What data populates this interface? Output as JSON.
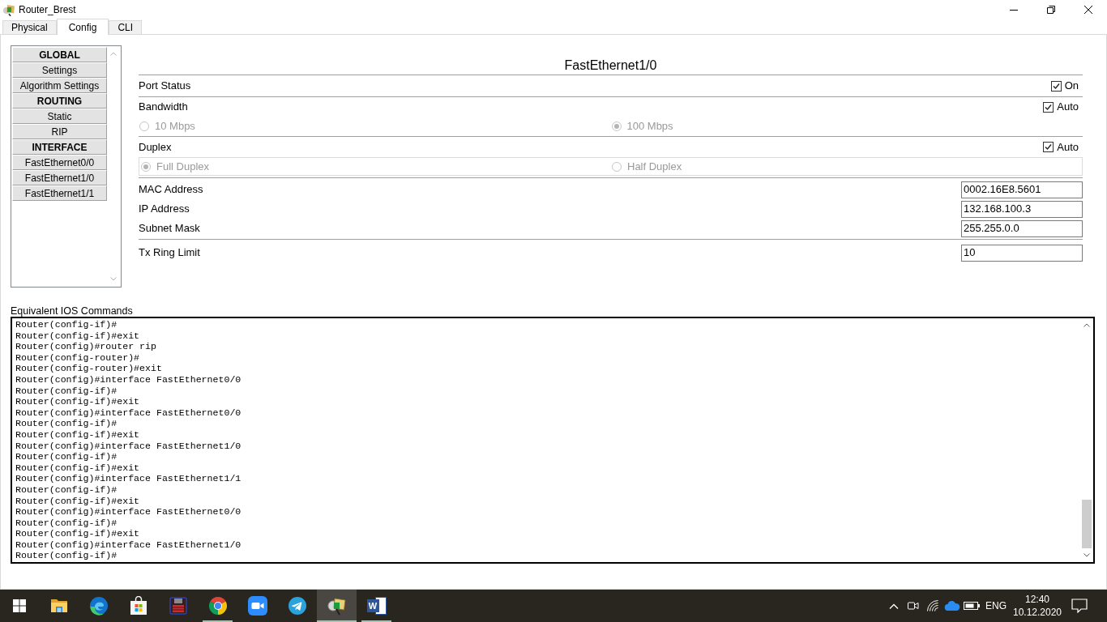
{
  "window": {
    "title": "Router_Brest"
  },
  "tabs": [
    {
      "label": "Physical",
      "selected": false
    },
    {
      "label": "Config",
      "selected": true
    },
    {
      "label": "CLI",
      "selected": false
    }
  ],
  "sidebar": {
    "items": [
      {
        "label": "GLOBAL",
        "kind": "header"
      },
      {
        "label": "Settings",
        "kind": "item"
      },
      {
        "label": "Algorithm Settings",
        "kind": "item"
      },
      {
        "label": "ROUTING",
        "kind": "header"
      },
      {
        "label": "Static",
        "kind": "item"
      },
      {
        "label": "RIP",
        "kind": "item"
      },
      {
        "label": "INTERFACE",
        "kind": "header"
      },
      {
        "label": "FastEthernet0/0",
        "kind": "item"
      },
      {
        "label": "FastEthernet1/0",
        "kind": "item"
      },
      {
        "label": "FastEthernet1/1",
        "kind": "item"
      }
    ]
  },
  "interface": {
    "title": "FastEthernet1/0",
    "port_status": {
      "label": "Port Status",
      "checkbox": {
        "label": "On",
        "checked": true
      }
    },
    "bandwidth": {
      "label": "Bandwidth",
      "auto": {
        "label": "Auto",
        "checked": true
      },
      "options": [
        {
          "label": "10 Mbps",
          "selected": false,
          "disabled": true
        },
        {
          "label": "100 Mbps",
          "selected": true,
          "disabled": true
        }
      ]
    },
    "duplex": {
      "label": "Duplex",
      "auto": {
        "label": "Auto",
        "checked": true
      },
      "options": [
        {
          "label": "Full Duplex",
          "selected": true,
          "disabled": true
        },
        {
          "label": "Half Duplex",
          "selected": false,
          "disabled": true
        }
      ]
    },
    "address_fields": [
      {
        "label": "MAC Address",
        "value": "0002.16E8.5601"
      },
      {
        "label": "IP Address",
        "value": "132.168.100.3"
      },
      {
        "label": "Subnet Mask",
        "value": "255.255.0.0"
      }
    ],
    "tx_ring_limit": {
      "label": "Tx Ring Limit",
      "value": "10"
    }
  },
  "ios_commands": {
    "label": "Equivalent IOS Commands",
    "lines": [
      "Router(config-if)#",
      "Router(config-if)#exit",
      "Router(config)#router rip",
      "Router(config-router)#",
      "Router(config-router)#exit",
      "Router(config)#interface FastEthernet0/0",
      "Router(config-if)#",
      "Router(config-if)#exit",
      "Router(config)#interface FastEthernet0/0",
      "Router(config-if)#",
      "Router(config-if)#exit",
      "Router(config)#interface FastEthernet1/0",
      "Router(config-if)#",
      "Router(config-if)#exit",
      "Router(config)#interface FastEthernet1/1",
      "Router(config-if)#",
      "Router(config-if)#exit",
      "Router(config)#interface FastEthernet0/0",
      "Router(config-if)#",
      "Router(config-if)#exit",
      "Router(config)#interface FastEthernet1/0",
      "Router(config-if)#"
    ]
  },
  "taskbar": {
    "apps": [
      {
        "kind": "folder",
        "running": false,
        "selected": false
      },
      {
        "kind": "swirl-browser",
        "running": false,
        "selected": false
      },
      {
        "kind": "store",
        "running": false,
        "selected": false
      },
      {
        "kind": "floppy",
        "running": false,
        "selected": false
      },
      {
        "kind": "ring-browser",
        "running": true,
        "selected": false
      },
      {
        "kind": "video",
        "running": false,
        "selected": false
      },
      {
        "kind": "messenger",
        "running": false,
        "selected": false
      },
      {
        "kind": "network-tool",
        "running": true,
        "selected": true
      },
      {
        "kind": "document",
        "glyph": "W",
        "running": true,
        "selected": false
      }
    ],
    "tray": {
      "language": "ENG",
      "time": "12:40",
      "date": "10.12.2020"
    }
  }
}
